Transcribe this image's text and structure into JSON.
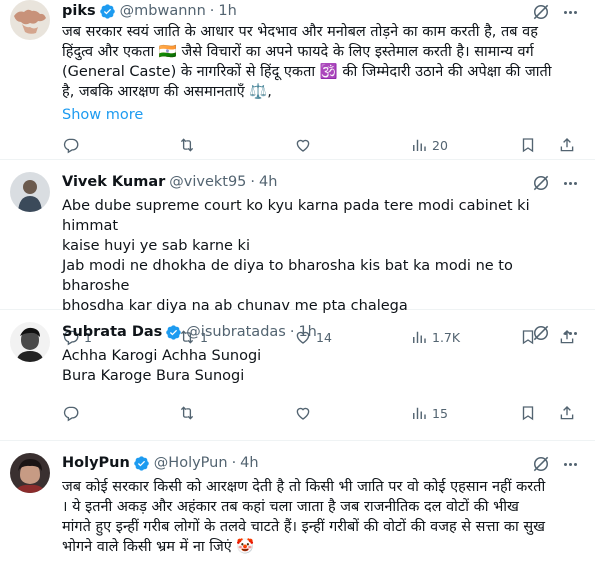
{
  "tweets": [
    {
      "name": "piks",
      "handle": "@mbwannn",
      "dot": "·",
      "time": "1h",
      "lines": [
        "जब सरकार स्वयं जाति के आधार पर भेदभाव और मनोबल तोड़ने का काम करती है, तब वह",
        "हिंदुत्व और एकता 🇮🇳 जैसे विचारों का अपने फायदे के लिए इस्तेमाल करती है। सामान्य वर्ग",
        "(General Caste) के नागरिकों से हिंदू एकता 🕉️ की जिम्मेदारी उठाने की अपेक्षा की जाती",
        "है, जबकि आरक्षण की असमानताएँ ⚖️,"
      ],
      "show_more": "Show more",
      "replies": "",
      "retweets": "",
      "likes": "",
      "views": "20"
    },
    {
      "name": "Vivek Kumar",
      "handle": "@vivekt95",
      "dot": "·",
      "time": "4h",
      "lines": [
        "Abe dube supreme court ko kyu karna pada tere modi cabinet ki himmat",
        "kaise huyi ye sab karne ki",
        "Jab modi ne dhokha de diya to bharosha kis bat ka modi ne to bharoshe",
        "bhosdha kar diya na ab chunav me pta chalega"
      ],
      "replies": "1",
      "retweets": "1",
      "likes": "14",
      "views": "1.7K"
    },
    {
      "name": "Subrata Das",
      "handle": "@isubratadas",
      "dot": "·",
      "time": "1h",
      "lines": [
        "Achha Karogi Achha Sunogi",
        "Bura Karoge Bura Sunogi"
      ],
      "replies": "",
      "retweets": "",
      "likes": "",
      "views": "15"
    },
    {
      "name": "HolyPun",
      "handle": "@HolyPun",
      "dot": "·",
      "time": "4h",
      "lines": [
        "जब कोई सरकार किसी को आरक्षण देती है तो किसी भी जाति पर वो कोई एहसान नहीं करती",
        "। ये इतनी अकड़ और अहंकार तब कहां चला जाता है जब राजनीतिक दल वोटों की भीख",
        "मांगते हुए इन्हीं गरीब लोगों के तलवे चाटते हैं। इन्हीं गरीबों की वोटों की वजह से सत्ता का सुख",
        "भोगने वाले किसी भ्रम में ना जिएं 🤡"
      ]
    }
  ],
  "icons": {
    "reply": "reply-icon",
    "retweet": "retweet-icon",
    "like": "heart-icon",
    "views": "views-icon",
    "bookmark": "bookmark-icon",
    "share": "share-icon",
    "grok": "grok-icon",
    "more": "more-icon",
    "verified": "verified-badge-icon"
  },
  "colors": {
    "text": "#0f1419",
    "secondary": "#536471",
    "link": "#1d9bf0",
    "verified": "#1d9bf0",
    "divider": "#eff3f4"
  }
}
